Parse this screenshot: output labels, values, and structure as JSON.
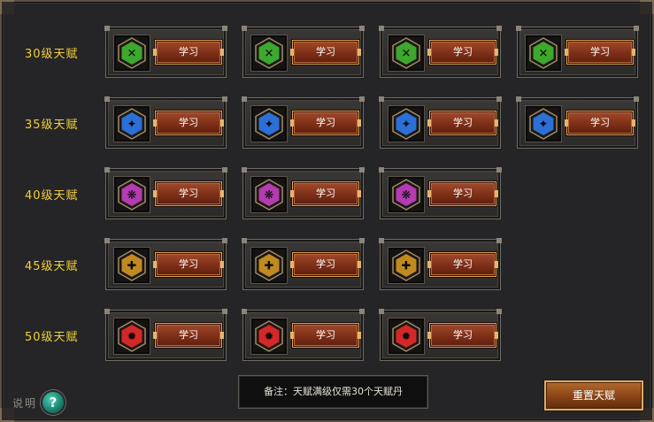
{
  "learn_label": "学习",
  "rows": [
    {
      "label": "30级天赋",
      "color": "#3ea82e",
      "glyph": "✕",
      "slots": [
        "blade",
        "blade",
        "gem",
        "gem"
      ]
    },
    {
      "label": "35级天赋",
      "color": "#2c6fd6",
      "glyph": "✦",
      "slots": [
        "wave",
        "star",
        "claw",
        "flame"
      ]
    },
    {
      "label": "40级天赋",
      "color": "#b43bb0",
      "glyph": "❋",
      "slots": [
        "horns",
        "flower",
        "mask"
      ]
    },
    {
      "label": "45级天赋",
      "color": "#c08a1e",
      "glyph": "✚",
      "slots": [
        "cross",
        "shield",
        "helm"
      ]
    },
    {
      "label": "50级天赋",
      "color": "#d42828",
      "glyph": "✹",
      "slots": [
        "heart",
        "rose",
        "fire"
      ]
    }
  ],
  "note": "备注：天赋满级仅需30个天赋丹",
  "reset_label": "重置天赋",
  "help_label": "说明",
  "help_glyph": "?"
}
